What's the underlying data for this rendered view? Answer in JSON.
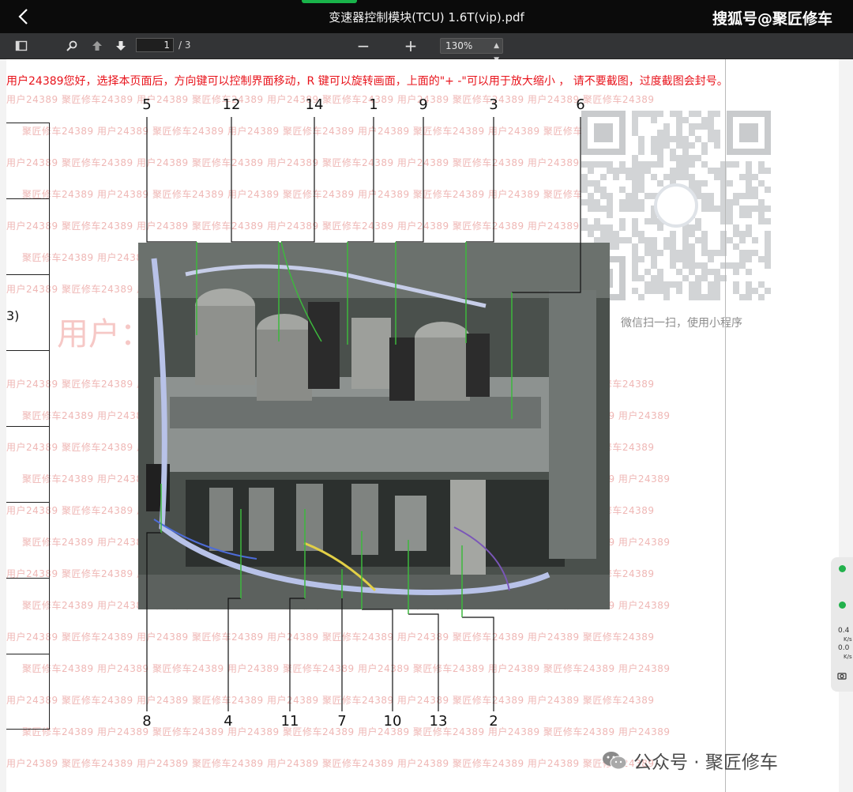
{
  "window": {
    "file_title": "变速器控制模块(TCU) 1.6T(vip).pdf",
    "brand": "搜狐号@聚匠修车"
  },
  "toolbar": {
    "page_current": "1",
    "page_total": "/ 3",
    "zoom_minus": "−",
    "zoom_plus": "+",
    "zoom_level": "130%"
  },
  "page": {
    "warning": "用户24389您好，选择本页面后，方向键可以控制界面移动，R 键可以旋转画面，上面的\"+ -\"可以用于放大缩小 ， 请不要截图，过度截图会封号。",
    "left_fragment": "3)",
    "qr_caption": "微信扫一扫，使用小程序",
    "watermark_big": "用户：24389 匠修车 用户24389",
    "watermark_lines": [
      "用户24389 聚匠修车24389 用户24389 聚匠修车24389 用户24389 聚匠修车24389 用户24389 聚匠修车24389 用户24389 聚匠修车24389",
      "聚匠修车24389 用户24389 聚匠修车24389 用户24389 聚匠修车24389 用户24389 聚匠修车24389 用户24389 聚匠修车24389 用户24389"
    ],
    "callouts_top": [
      "5",
      "12",
      "14",
      "1",
      "9",
      "3",
      "6"
    ],
    "callouts_bottom": [
      "8",
      "4",
      "11",
      "7",
      "10",
      "13",
      "2"
    ]
  },
  "footer": {
    "brand": "公众号 · 聚匠修车"
  },
  "side_control": {
    "up_value": "0.4",
    "up_unit": "K/s",
    "down_value": "0.0",
    "down_unit": "K/s"
  }
}
